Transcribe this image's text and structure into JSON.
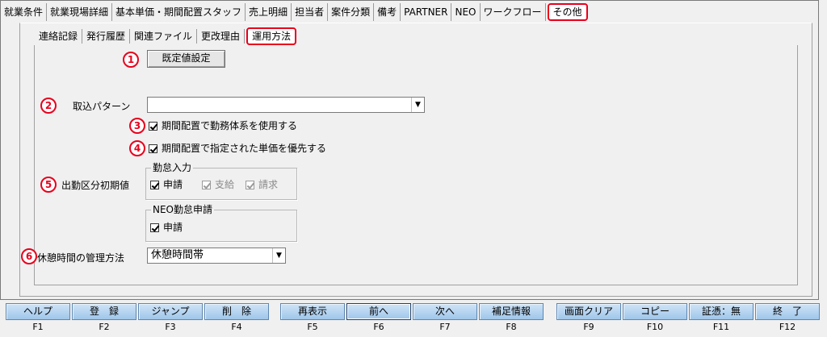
{
  "top_tabs": [
    "就業条件",
    "就業現場詳細",
    "基本単価・期間配置スタッフ",
    "売上明細",
    "担当者",
    "案件分類",
    "備考",
    "PARTNER",
    "NEO",
    "ワークフロー",
    "その他"
  ],
  "sub_tabs": [
    "連絡記録",
    "発行履歴",
    "関連ファイル",
    "更改理由",
    "運用方法"
  ],
  "badges": [
    "1",
    "2",
    "3",
    "4",
    "5",
    "6"
  ],
  "form": {
    "default_button": "既定値設定",
    "import_pattern_label": "取込パターン",
    "import_pattern_value": "",
    "use_work_system_label": "期間配置で勤務体系を使用する",
    "prioritize_price_label": "期間配置で指定された単価を優先する",
    "attendance_initial_label": "出勤区分初期値",
    "attendance_input_group": "勤怠入力",
    "attendance_apply": "申請",
    "attendance_pay": "支給",
    "attendance_bill": "請求",
    "neo_group": "NEO勤怠申請",
    "neo_apply": "申請",
    "break_label": "休憩時間の管理方法",
    "break_value": "休憩時間帯"
  },
  "fkeys": [
    {
      "label": "ヘルプ",
      "key": "F1"
    },
    {
      "label": "登　録",
      "key": "F2"
    },
    {
      "label": "ジャンプ",
      "key": "F3"
    },
    {
      "label": "削　除",
      "key": "F4"
    },
    {
      "label": "再表示",
      "key": "F5"
    },
    {
      "label": "前へ",
      "key": "F6"
    },
    {
      "label": "次へ",
      "key": "F7"
    },
    {
      "label": "補足情報",
      "key": "F8"
    },
    {
      "label": "画面クリア",
      "key": "F9"
    },
    {
      "label": "コピー",
      "key": "F10"
    },
    {
      "label": "証憑：無",
      "key": "F11"
    },
    {
      "label": "終　了",
      "key": "F12"
    }
  ],
  "colors": {
    "highlight": "#e8001c",
    "fkey": "#9fc6ea"
  }
}
